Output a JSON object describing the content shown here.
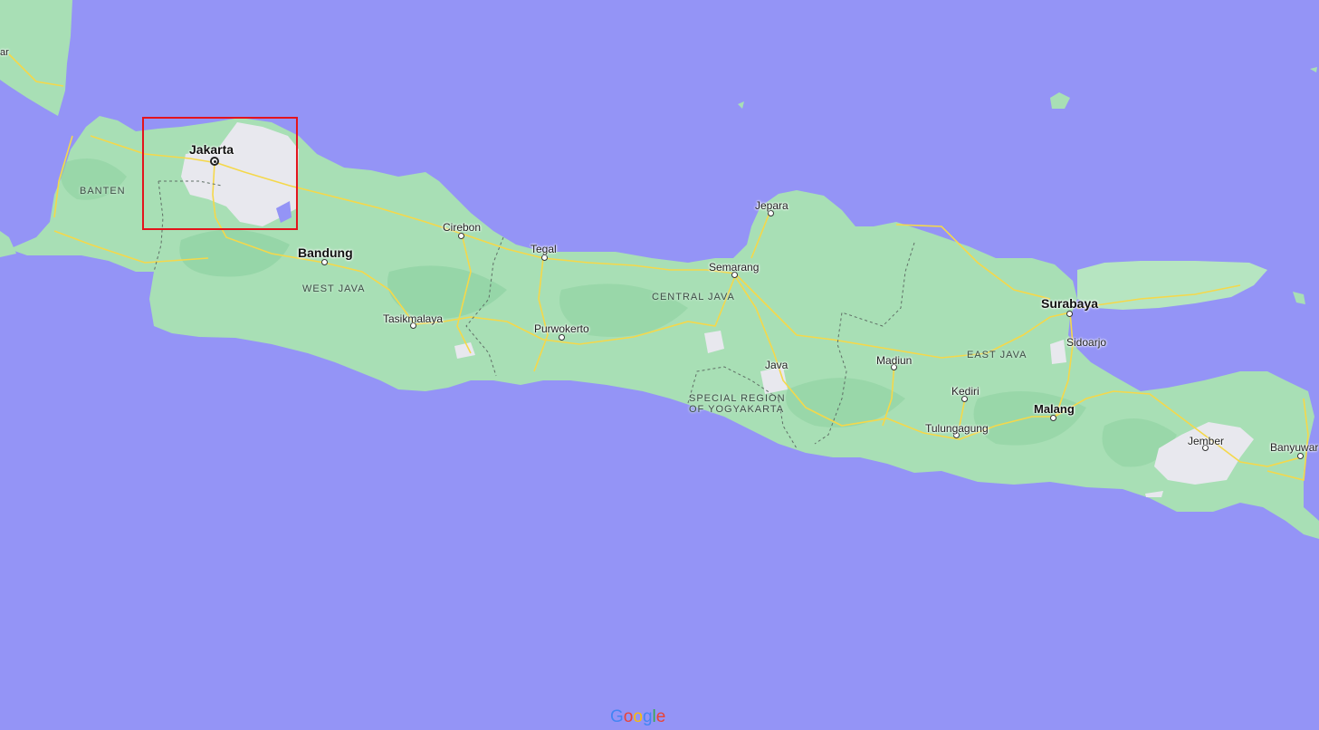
{
  "map": {
    "logo": {
      "letters": [
        "G",
        "o",
        "o",
        "g",
        "l",
        "e"
      ],
      "colors": [
        "#4285f4",
        "#ea4335",
        "#fbbc05",
        "#4285f4",
        "#34a853",
        "#ea4335"
      ]
    },
    "colors": {
      "water": "#9494f6",
      "land": "#a8dfb5",
      "land_dark": "#8fd2a2",
      "urban": "#e8e8ee",
      "road": "#f5d84a",
      "highlight_box": "#e3141d"
    },
    "cities": [
      {
        "id": "jakarta",
        "name": "Jakarta",
        "capital": true
      },
      {
        "id": "bandung",
        "name": "Bandung",
        "major": true
      },
      {
        "id": "cirebon",
        "name": "Cirebon"
      },
      {
        "id": "tegal",
        "name": "Tegal"
      },
      {
        "id": "semarang",
        "name": "Semarang"
      },
      {
        "id": "jepara",
        "name": "Jepara"
      },
      {
        "id": "tasikmalaya",
        "name": "Tasikmalaya"
      },
      {
        "id": "purwokerto",
        "name": "Purwokerto"
      },
      {
        "id": "java",
        "name": "Java"
      },
      {
        "id": "madiun",
        "name": "Madiun"
      },
      {
        "id": "kediri",
        "name": "Kediri"
      },
      {
        "id": "tulungagung",
        "name": "Tulungagung"
      },
      {
        "id": "malang",
        "name": "Malang",
        "major": true
      },
      {
        "id": "surabaya",
        "name": "Surabaya",
        "major": true
      },
      {
        "id": "sidoarjo",
        "name": "Sidoarjo"
      },
      {
        "id": "jember",
        "name": "Jember"
      },
      {
        "id": "banyuwangi",
        "name": "Banyuwar"
      }
    ],
    "regions": [
      {
        "id": "banten",
        "name": "BANTEN"
      },
      {
        "id": "west-java",
        "name": "WEST JAVA"
      },
      {
        "id": "central-java",
        "name": "CENTRAL JAVA"
      },
      {
        "id": "yogyakarta",
        "line1": "SPECIAL REGION",
        "line2": "OF YOGYAKARTA"
      },
      {
        "id": "east-java",
        "name": "EAST JAVA"
      }
    ],
    "sumatra_label_fragment": "ar"
  }
}
